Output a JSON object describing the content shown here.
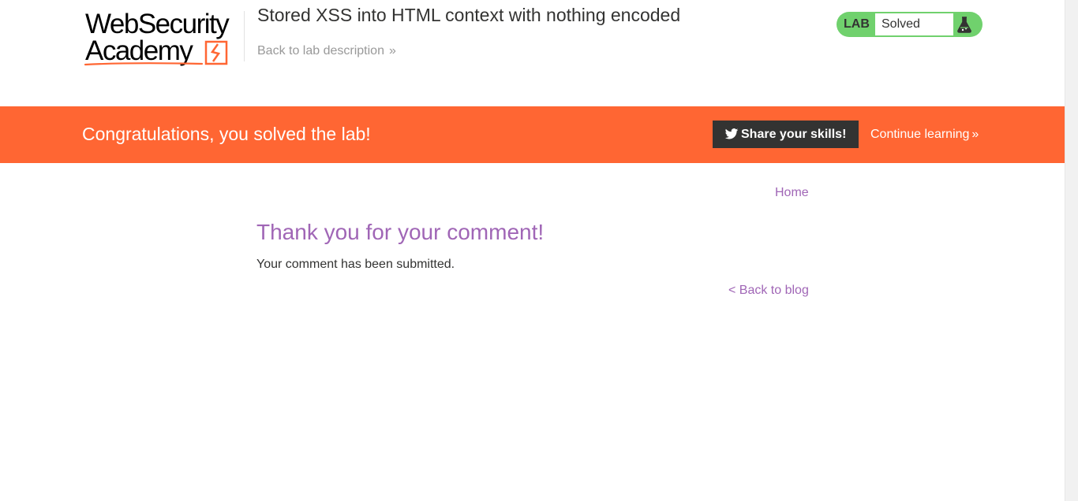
{
  "header": {
    "logo": {
      "line1": "WebSecurity",
      "line2": "Academy"
    },
    "lab_title": "Stored XSS into HTML context with nothing encoded",
    "back_link": "Back to lab description",
    "chevron": "»"
  },
  "lab_status": {
    "label": "LAB",
    "state": "Solved",
    "icon": "flask-icon",
    "color": "#70d16d"
  },
  "banner": {
    "message": "Congratulations, you solved the lab!",
    "share_button": "Share your skills!",
    "share_icon": "twitter-icon",
    "continue_link": "Continue learning",
    "chevron": "»",
    "color": "#ff6633"
  },
  "nav": {
    "home": "Home"
  },
  "main": {
    "heading": "Thank you for your comment!",
    "message": "Your comment has been submitted.",
    "back_link": "< Back to blog"
  },
  "colors": {
    "accent": "#a066b6",
    "text": "#333332",
    "muted": "#999999"
  }
}
